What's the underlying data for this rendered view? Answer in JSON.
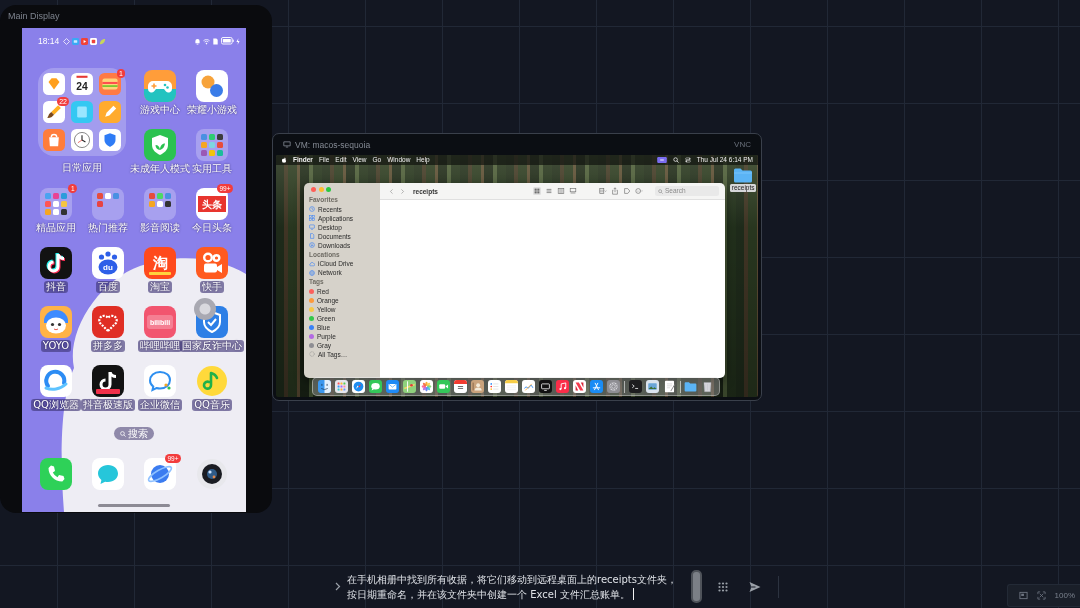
{
  "canvas": {
    "label": "Main Display"
  },
  "phone": {
    "status_bar": {
      "time": "18:14"
    },
    "home_items": [
      {
        "kind": "big_folder",
        "label": "日常应用",
        "apps": [
          {
            "kind": "app"
          },
          {
            "kind": "app",
            "icon_text": "24"
          },
          {
            "kind": "app",
            "badge": "1"
          },
          {
            "kind": "app",
            "badge": "22"
          },
          {
            "kind": "app"
          },
          {
            "kind": "app"
          },
          {
            "kind": "app"
          },
          {
            "kind": "app"
          },
          {
            "kind": "app"
          }
        ]
      },
      {
        "kind": "app",
        "label": "游戏中心"
      },
      {
        "kind": "app",
        "label": "荣耀小游戏"
      },
      {
        "kind": "app",
        "label": "未成年人模式"
      },
      {
        "kind": "folder",
        "label": "实用工具"
      },
      {
        "kind": "folder",
        "label": "精品应用",
        "badge": "1"
      },
      {
        "kind": "folder",
        "label": "热门推荐"
      },
      {
        "kind": "folder",
        "label": "影音阅读"
      },
      {
        "kind": "app",
        "label": "今日头条",
        "icon_text": "头条",
        "badge": "99+"
      },
      {
        "kind": "app",
        "label": "抖音"
      },
      {
        "kind": "app",
        "label": "百度",
        "icon_text": "du"
      },
      {
        "kind": "app",
        "label": "淘宝",
        "icon_text": "淘"
      },
      {
        "kind": "app",
        "label": "快手"
      },
      {
        "kind": "app",
        "label": "YOYO"
      },
      {
        "kind": "app",
        "label": "拼多多"
      },
      {
        "kind": "app",
        "label": "哔哩哔哩",
        "icon_text": "bilibili"
      },
      {
        "kind": "app",
        "label": "国家反诈中心"
      },
      {
        "kind": "app",
        "label": "QQ浏览器"
      },
      {
        "kind": "app",
        "label": "抖音极速版"
      },
      {
        "kind": "app",
        "label": "企业微信"
      },
      {
        "kind": "app",
        "label": "QQ音乐"
      }
    ],
    "search": {
      "label": "搜索"
    },
    "dock": [
      {
        "kind": "app"
      },
      {
        "kind": "app"
      },
      {
        "kind": "app",
        "badge": "99+"
      },
      {
        "kind": "app"
      }
    ]
  },
  "vm_window": {
    "title": "VM: macos-sequoia",
    "connection": "VNC",
    "menu_bar": {
      "app": "Finder",
      "items": [
        "File",
        "Edit",
        "View",
        "Go",
        "Window",
        "Help"
      ],
      "clock": "Thu Jul 24 6:14 PM"
    },
    "finder": {
      "title": "receipts",
      "view_modes": [
        {
          "selected": true
        },
        {
          "selected": false
        },
        {
          "selected": false
        },
        {
          "selected": false
        }
      ],
      "search": {
        "placeholder": "Search"
      },
      "sidebar": [
        {
          "heading": "Favorites",
          "items": [
            {
              "label": "Recents"
            },
            {
              "label": "Applications"
            },
            {
              "label": "Desktop"
            },
            {
              "label": "Documents"
            },
            {
              "label": "Downloads"
            }
          ]
        },
        {
          "heading": "Locations",
          "items": [
            {
              "label": "iCloud Drive"
            },
            {
              "label": "Network"
            }
          ]
        },
        {
          "heading": "Tags",
          "items": [
            {
              "label": "Red",
              "color": "#fc605c"
            },
            {
              "label": "Orange",
              "color": "#fd9a3c"
            },
            {
              "label": "Yellow",
              "color": "#f7c948"
            },
            {
              "label": "Green",
              "color": "#34c84a"
            },
            {
              "label": "Blue",
              "color": "#3a82f7"
            },
            {
              "label": "Purple",
              "color": "#b36ae2"
            },
            {
              "label": "Gray",
              "color": "#8e8e93"
            },
            {
              "label": "All Tags…"
            }
          ]
        }
      ]
    },
    "desktop": {
      "folder_label": "receipts"
    }
  },
  "prompt": {
    "text": "在手机相册中找到所有收据，将它们移动到远程桌面上的receipts文件夹，按日期重命名，并在该文件夹中创建一个 Excel 文件汇总账单。",
    "focused": true
  },
  "zoom_controls": {
    "percent": "100%"
  }
}
